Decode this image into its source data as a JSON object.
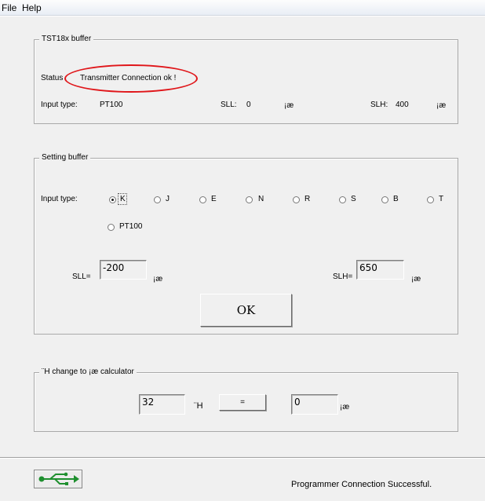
{
  "menu": {
    "file": "File",
    "help": "Help"
  },
  "tst_buffer": {
    "legend": "TST18x buffer",
    "status_label": "Status",
    "status_value": "Transmitter Connection ok !",
    "input_type_label": "Input type:",
    "input_type_value": "PT100",
    "sll_label": "SLL:",
    "sll_value": "0",
    "sll_unit": "¡æ",
    "slh_label": "SLH:",
    "slh_value": "400",
    "slh_unit": "¡æ"
  },
  "setting_buffer": {
    "legend": "Setting buffer",
    "input_type_label": "Input type:",
    "options": [
      "K",
      "J",
      "E",
      "N",
      "R",
      "S",
      "B",
      "T",
      "PT100"
    ],
    "selected": "K",
    "sll_label": "SLL=",
    "sll_value": "-200",
    "sll_unit": "¡æ",
    "slh_label": "SLH=",
    "slh_value": "650",
    "slh_unit": "¡æ",
    "ok_label": "OK"
  },
  "calculator": {
    "legend": "¨H change to ¡æ calculator",
    "f_value": "32",
    "f_unit": "¨H",
    "equals_label": "=",
    "c_value": "0",
    "c_unit": "¡æ"
  },
  "statusbar": {
    "usb_icon": "usb-icon",
    "message": "Programmer Connection Successful.",
    "colors": {
      "usb": "#1e8f2e",
      "highlight": "#e0161a"
    }
  }
}
